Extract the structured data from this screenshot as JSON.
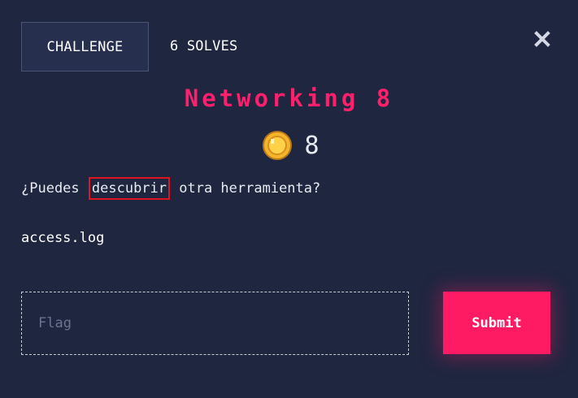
{
  "tabs": {
    "challenge_label": "CHALLENGE",
    "solves_label": "6 SOLVES"
  },
  "challenge": {
    "title": "Networking 8",
    "points": "8",
    "description_before": "¿Puedes ",
    "description_highlight": "descubrir",
    "description_after": " otra herramienta?",
    "file_name": "access.log"
  },
  "form": {
    "flag_placeholder": "Flag",
    "flag_value": "",
    "submit_label": "Submit"
  },
  "icons": {
    "close": "close-icon",
    "coin": "coin-icon"
  },
  "colors": {
    "background": "#1f2640",
    "accent": "#ff1a64",
    "title": "#ff1f6d",
    "highlight_border": "#e0141f",
    "coin": "#f5b52a"
  }
}
